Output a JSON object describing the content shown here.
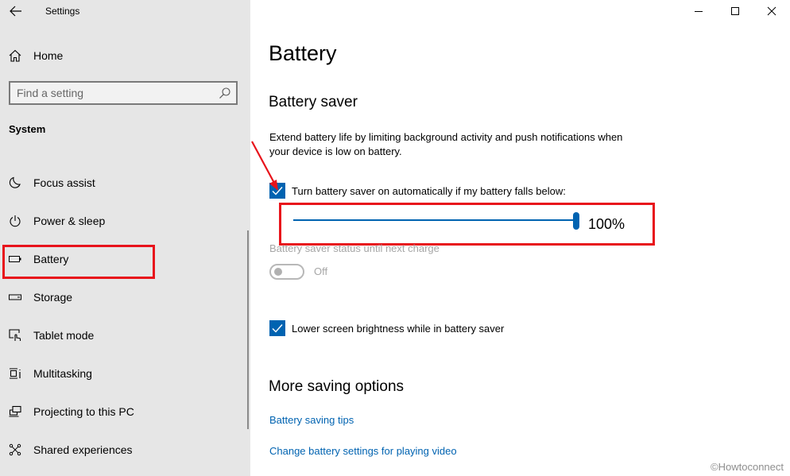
{
  "window": {
    "app_title": "Settings",
    "controls": {
      "minimize": "minimize-icon",
      "maximize": "maximize-icon",
      "close": "close-icon"
    }
  },
  "sidebar": {
    "home_label": "Home",
    "search": {
      "placeholder": "Find a setting",
      "value": ""
    },
    "section": "System",
    "items": [
      {
        "label": "Focus assist",
        "icon": "moon-icon"
      },
      {
        "label": "Power & sleep",
        "icon": "power-icon"
      },
      {
        "label": "Battery",
        "icon": "battery-icon",
        "selected": true
      },
      {
        "label": "Storage",
        "icon": "storage-icon"
      },
      {
        "label": "Tablet mode",
        "icon": "tablet-mode-icon"
      },
      {
        "label": "Multitasking",
        "icon": "multitasking-icon"
      },
      {
        "label": "Projecting to this PC",
        "icon": "projecting-icon"
      },
      {
        "label": "Shared experiences",
        "icon": "shared-experiences-icon"
      }
    ]
  },
  "main": {
    "title": "Battery",
    "battery_saver": {
      "heading": "Battery saver",
      "description": "Extend battery life by limiting background activity and push notifications when your device is low on battery.",
      "auto_checkbox": {
        "label": "Turn battery saver on automatically if my battery falls below:",
        "checked": true
      },
      "threshold": {
        "value": 100,
        "max": 100,
        "display": "100%"
      },
      "status_label": "Battery saver status until next charge",
      "status_toggle": {
        "state": "Off",
        "enabled": false
      },
      "brightness_checkbox": {
        "label": "Lower screen brightness while in battery saver",
        "checked": true
      }
    },
    "more_options": {
      "heading": "More saving options",
      "links": [
        "Battery saving tips",
        "Change battery settings for playing video"
      ]
    }
  },
  "colors": {
    "accent": "#0063b1",
    "sidebar_bg": "#e6e6e6",
    "annotation_red": "#e8131b"
  },
  "watermark": "©Howtoconnect"
}
